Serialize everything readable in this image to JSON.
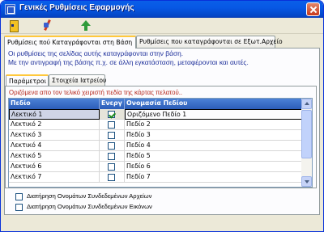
{
  "window": {
    "title": "Γενικές Ρυθμίσεις Εφαρμογής"
  },
  "toolbar": {
    "icons": [
      "exit-icon",
      "tools-icon",
      "arrow-up-icon"
    ]
  },
  "main_tabs": [
    {
      "label": "Ρυθμίσεις πού Καταγράφονται στη Βάση",
      "active": true
    },
    {
      "label": "Ρυθμίσεις που καταγράφονται σε Εξωτ.Αρχείο",
      "active": false
    }
  ],
  "info": {
    "line1": "Οι ρυθμίσεις της σελίδας αυτής καταγράφονται στην βάση.",
    "line2": "Με την αντιγραφή της βάσης π.χ. σε άλλη εγκατάσταση, μεταφέρονται και αυτές."
  },
  "sub_tabs": [
    {
      "label": "Παράμετροι",
      "active": true
    },
    {
      "label": "Στοιχεία Ιατρείου",
      "active": false
    }
  ],
  "hint": "Οριζόμενα απο τον τελικό χειριστή πεδία της κάρτας πελατού..",
  "grid": {
    "columns": [
      "Πεδίο",
      "Ενεργ",
      "Ονομασία Πεδίου"
    ],
    "rows": [
      {
        "field": "Λεκτικό 1",
        "active": true,
        "name": "Οριζόμενο Πεδίο 1"
      },
      {
        "field": "Λεκτικό 2",
        "active": false,
        "name": "Πεδίο 2"
      },
      {
        "field": "Λεκτικό 3",
        "active": false,
        "name": "Πεδίο 3"
      },
      {
        "field": "Λεκτικό 4",
        "active": false,
        "name": "Πεδίο 4"
      },
      {
        "field": "Λεκτικό 5",
        "active": false,
        "name": "Πεδίο 5"
      },
      {
        "field": "Λεκτικό 6",
        "active": false,
        "name": "Πεδίο 6"
      },
      {
        "field": "Λεκτικό 7",
        "active": false,
        "name": "Πεδίο 7"
      }
    ]
  },
  "options": [
    {
      "label": "Διατήρηση Ονομάτων Συνδεδεμένων Αρχείων",
      "checked": false
    },
    {
      "label": "Διατήρηση Ονομάτων Συνδεδεμένων Εικόνων",
      "checked": false
    }
  ]
}
